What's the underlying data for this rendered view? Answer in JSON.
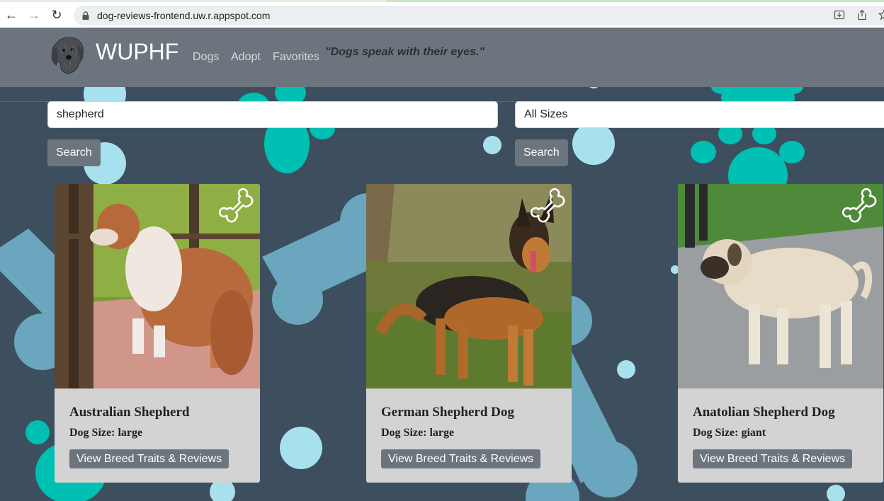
{
  "browser": {
    "url": "dog-reviews-frontend.uw.r.appspot.com",
    "back_icon": "←",
    "forward_icon": "→",
    "reload_icon": "↻"
  },
  "navbar": {
    "brand": "WUPHF",
    "links": [
      "Dogs",
      "Adopt",
      "Favorites"
    ],
    "quote": "\"Dogs speak with their eyes.\""
  },
  "search": {
    "query_value": "shepherd",
    "size_selected": "All Sizes",
    "search_label": "Search",
    "filter_search_label": "Search"
  },
  "cards": [
    {
      "title": "Australian Shepherd",
      "size_label": "Dog Size:",
      "size": "large",
      "button": "View Breed Traits & Reviews"
    },
    {
      "title": "German Shepherd Dog",
      "size_label": "Dog Size:",
      "size": "large",
      "button": "View Breed Traits & Reviews"
    },
    {
      "title": "Anatolian Shepherd Dog",
      "size_label": "Dog Size:",
      "size": "giant",
      "button": "View Breed Traits & Reviews"
    }
  ],
  "colors": {
    "page_bg": "#3d4f5e",
    "navbar_bg": "#6c757d",
    "paw_teal": "#00bfb3",
    "dot_light_blue": "#a8e1ee",
    "bone_blue": "#6aa7be",
    "card_bg": "#d3d3d3"
  }
}
